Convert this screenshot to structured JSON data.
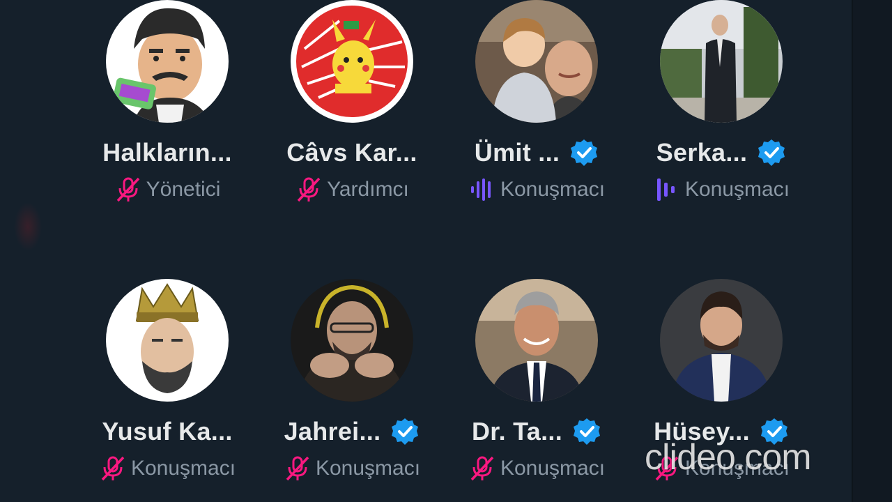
{
  "participants": [
    {
      "name": "Halkların...",
      "role": "Yönetici",
      "verified": false,
      "status": "muted"
    },
    {
      "name": "Câvs Kar...",
      "role": "Yardımcı",
      "verified": false,
      "status": "muted"
    },
    {
      "name": "Ümit ...",
      "role": "Konuşmacı",
      "verified": true,
      "status": "speaking"
    },
    {
      "name": "Serka...",
      "role": "Konuşmacı",
      "verified": true,
      "status": "speaking"
    },
    {
      "name": "Yusuf Ka...",
      "role": "Konuşmacı",
      "verified": false,
      "status": "muted"
    },
    {
      "name": "Jahrei...",
      "role": "Konuşmacı",
      "verified": true,
      "status": "muted"
    },
    {
      "name": "Dr. Ta...",
      "role": "Konuşmacı",
      "verified": true,
      "status": "muted"
    },
    {
      "name": "Hüsey...",
      "role": "Konuşmacı",
      "verified": true,
      "status": "muted"
    }
  ],
  "watermark": "clideo.com",
  "colors": {
    "background": "#15202b",
    "name": "#e7e9ea",
    "role": "#8b98a5",
    "muted_icon": "#f91880",
    "speaking_icon": "#7856ff",
    "verified": "#1d9bf0"
  }
}
